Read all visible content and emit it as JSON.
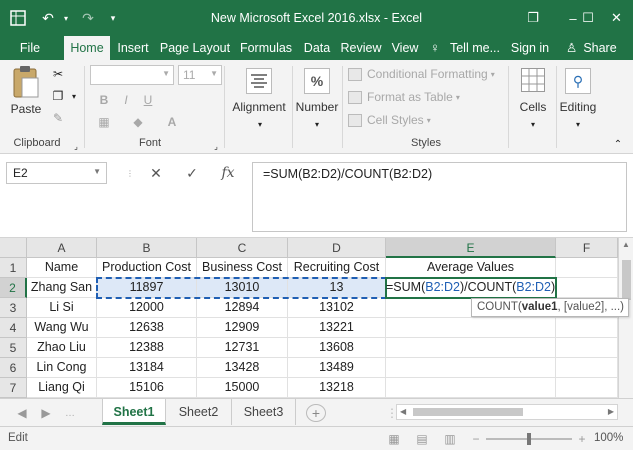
{
  "window": {
    "title": "New Microsoft Excel 2016.xlsx - Excel",
    "restore_glyph": "❐",
    "min_glyph": "–",
    "max_glyph": "☐",
    "close_glyph": "✕"
  },
  "ribbon_tabs": [
    "File",
    "Home",
    "Insert",
    "Page Layout",
    "Formulas",
    "Data",
    "Review",
    "View",
    "Tell me...",
    "Sign in",
    "Share"
  ],
  "ribbon": {
    "clipboard": {
      "paste": "Paste",
      "label": "Clipboard"
    },
    "font": {
      "name_value": "",
      "size_value": "11",
      "label": "Font",
      "bold": "B",
      "italic": "I",
      "underline": "U"
    },
    "alignment": {
      "label": "Alignment"
    },
    "number": {
      "label": "Number",
      "icon_glyph": "%"
    },
    "styles": {
      "conditional": "Conditional Formatting",
      "format_table": "Format as Table",
      "cell_styles": "Cell Styles",
      "label": "Styles"
    },
    "cells": {
      "label": "Cells"
    },
    "editing": {
      "label": "Editing"
    }
  },
  "formula_bar": {
    "name_box": "E2",
    "cancel_glyph": "✕",
    "enter_glyph": "✓",
    "fx_glyph": "fx",
    "formula": "=SUM(B2:D2)/COUNT(B2:D2)"
  },
  "sheet": {
    "columns": [
      "A",
      "B",
      "C",
      "D",
      "E",
      "F"
    ],
    "rows": [
      "1",
      "2",
      "3",
      "4",
      "5",
      "6",
      "7"
    ],
    "header": [
      "Name",
      "Production Cost",
      "Business Cost",
      "Recruiting Cost",
      "Average Values"
    ],
    "data": [
      [
        "Zhang San",
        "11897",
        "13010",
        "13"
      ],
      [
        "Li Si",
        "12000",
        "12894",
        "13102"
      ],
      [
        "Wang Wu",
        "12638",
        "12909",
        "13221"
      ],
      [
        "Zhao Liu",
        "12388",
        "12731",
        "13608"
      ],
      [
        "Lin Cong",
        "13184",
        "13428",
        "13489"
      ],
      [
        "Liang Qi",
        "15106",
        "15000",
        "13218"
      ]
    ],
    "edit_formula": {
      "p1": "=SUM(",
      "ref1": "B2:D2",
      "p2": ")/COUNT(",
      "ref2": "B2:D2",
      "p3": ")"
    },
    "tooltip": {
      "fn": "COUNT(",
      "arg1": "value1",
      "rest": ", [value2], ...)"
    }
  },
  "sheet_tabs": [
    "Sheet1",
    "Sheet2",
    "Sheet3"
  ],
  "status": {
    "mode": "Edit",
    "zoom": "100%"
  },
  "colors": {
    "accent": "#217346",
    "ref": "#1f5fb4"
  }
}
